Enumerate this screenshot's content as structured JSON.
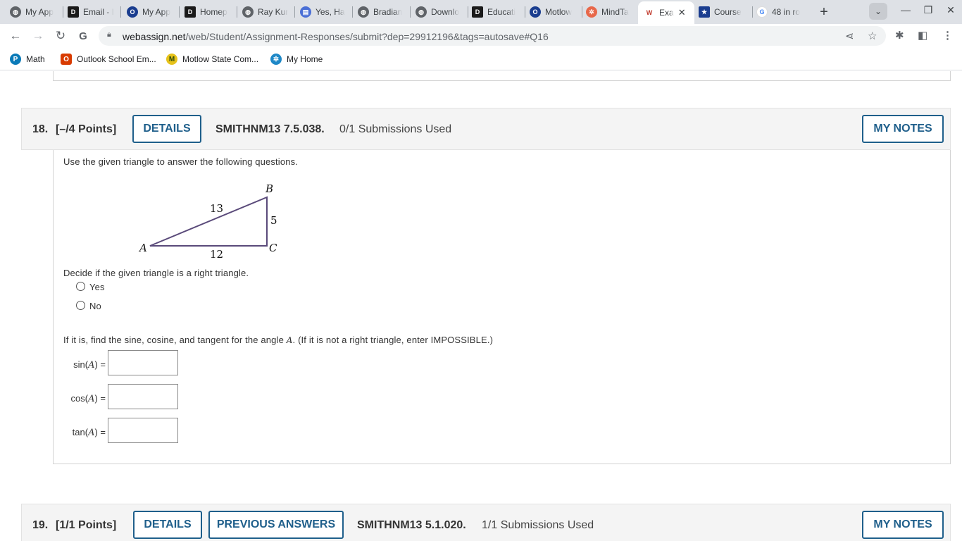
{
  "browser": {
    "tabs": [
      {
        "title": "My App",
        "icon": "globe-icon",
        "color": "#5f6368"
      },
      {
        "title": "Email - I",
        "icon": "d2l-icon",
        "color": "#1a1a1a"
      },
      {
        "title": "My App",
        "icon": "circle-o-icon",
        "color": "#1a3d8f"
      },
      {
        "title": "Homep",
        "icon": "d2l-icon",
        "color": "#1a1a1a"
      },
      {
        "title": "Ray Kur",
        "icon": "globe-icon",
        "color": "#5f6368"
      },
      {
        "title": "Yes, Ha",
        "icon": "chart-icon",
        "color": "#4a6fd6"
      },
      {
        "title": "Bradian",
        "icon": "globe-icon",
        "color": "#5f6368"
      },
      {
        "title": "Downlo",
        "icon": "globe-icon",
        "color": "#5f6368"
      },
      {
        "title": "Educati",
        "icon": "d2l-icon",
        "color": "#1a1a1a"
      },
      {
        "title": "Motlow",
        "icon": "circle-o-icon",
        "color": "#1a3d8f"
      },
      {
        "title": "MindTa",
        "icon": "pinwheel-icon",
        "color": "#e8684a"
      },
      {
        "title": "Exa",
        "icon": "webassign-icon",
        "color": "#c0392b",
        "active": true
      },
      {
        "title": "Course",
        "icon": "star-shield-icon",
        "color": "#1a3d8f"
      },
      {
        "title": "48 in ro",
        "icon": "google-icon",
        "color": "#4285f4"
      }
    ],
    "url_host": "webassign.net",
    "url_path": "/web/Student/Assignment-Responses/submit?dep=29912196&tags=autosave#Q16",
    "bookmarks": [
      {
        "label": "Math",
        "icon": "pearson-icon",
        "color": "#0a7ab8"
      },
      {
        "label": "Outlook School Em...",
        "icon": "office-icon",
        "color": "#d83b01"
      },
      {
        "label": "Motlow State Com...",
        "icon": "motlow-icon",
        "color": "#6a8f1c"
      },
      {
        "label": "My Home",
        "icon": "pinwheel-icon",
        "color": "#1e88c7"
      }
    ]
  },
  "q18": {
    "number": "18.",
    "points": "[–/4 Points]",
    "details_label": "DETAILS",
    "code": "SMITHNM13 7.5.038.",
    "submissions": "0/1 Submissions Used",
    "notes_label": "MY NOTES",
    "prompt": "Use the given triangle to answer the following questions.",
    "triangle": {
      "vertex_a": "A",
      "vertex_b": "B",
      "vertex_c": "C",
      "side_ab": "13",
      "side_bc": "5",
      "side_ac": "12"
    },
    "decide_text": "Decide if the given triangle is a right triangle.",
    "options": [
      "Yes",
      "No"
    ],
    "instruction_pre": "If it is, find the sine, cosine, and tangent for the angle ",
    "instruction_var": "A",
    "instruction_post": ". (If it is not a right triangle, enter IMPOSSIBLE.)",
    "answers": [
      {
        "fn": "sin(",
        "var": "A",
        "close": ") =",
        "value": ""
      },
      {
        "fn": "cos(",
        "var": "A",
        "close": ") =",
        "value": ""
      },
      {
        "fn": "tan(",
        "var": "A",
        "close": ") =",
        "value": ""
      }
    ]
  },
  "q19": {
    "number": "19.",
    "points": "[1/1 Points]",
    "details_label": "DETAILS",
    "previous_label": "PREVIOUS ANSWERS",
    "code": "SMITHNM13 5.1.020.",
    "submissions": "1/1 Submissions Used",
    "notes_label": "MY NOTES"
  },
  "colors": {
    "accent": "#1f5f8b",
    "triangle_stroke": "#5a4a7a"
  }
}
